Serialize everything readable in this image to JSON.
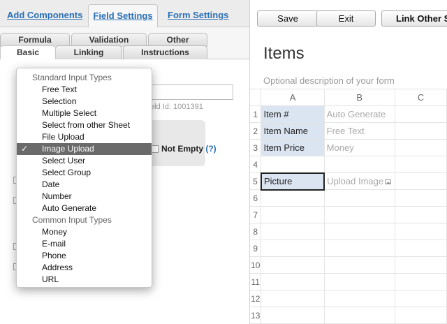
{
  "top_tabs": {
    "add_components": "Add Components",
    "field_settings": "Field Settings",
    "form_settings": "Form Settings"
  },
  "sub_tabs": {
    "formula": "Formula",
    "validation": "Validation",
    "other": "Other",
    "basic": "Basic",
    "linking": "Linking",
    "instructions": "Instructions"
  },
  "field": {
    "id_label": "eld Id: 1001391",
    "not_empty_label": "Not Empty",
    "not_empty_help": "(?)"
  },
  "dropdown": {
    "group_standard": "Standard Input Types",
    "standard_items": [
      "Free Text",
      "Selection",
      "Multiple Select",
      "Select from other Sheet",
      "File Upload",
      "Image Upload",
      "Select User",
      "Select Group",
      "Date",
      "Number",
      "Auto Generate"
    ],
    "selected": "Image Upload",
    "check_mark": "✓",
    "group_common": "Common Input Types",
    "common_items": [
      "Money",
      "E-mail",
      "Phone",
      "Address",
      "URL"
    ]
  },
  "toolbar": {
    "save": "Save",
    "exit": "Exit",
    "link_other": "Link Other S"
  },
  "form": {
    "title": "Items",
    "description": "Optional description of your form"
  },
  "grid": {
    "columns": [
      "A",
      "B",
      "C"
    ],
    "rows": [
      {
        "num": "1",
        "label": "Item #",
        "placeholder": "Auto Generate"
      },
      {
        "num": "2",
        "label": "Item Name",
        "placeholder": "Free Text"
      },
      {
        "num": "3",
        "label": "Item Price",
        "placeholder": "Money"
      },
      {
        "num": "4",
        "label": "",
        "placeholder": ""
      },
      {
        "num": "5",
        "label": "Picture",
        "placeholder": "Upload Image"
      },
      {
        "num": "6",
        "label": "",
        "placeholder": ""
      },
      {
        "num": "7",
        "label": "",
        "placeholder": ""
      },
      {
        "num": "8",
        "label": "",
        "placeholder": ""
      },
      {
        "num": "9",
        "label": "",
        "placeholder": ""
      },
      {
        "num": "10",
        "label": "",
        "placeholder": ""
      },
      {
        "num": "11",
        "label": "",
        "placeholder": ""
      },
      {
        "num": "12",
        "label": "",
        "placeholder": ""
      },
      {
        "num": "13",
        "label": "",
        "placeholder": ""
      }
    ]
  },
  "colors": {
    "link_blue": "#2a6fb5",
    "label_cell_bg": "#dbe5f1",
    "menu_selected_bg": "#6a6a6a"
  }
}
